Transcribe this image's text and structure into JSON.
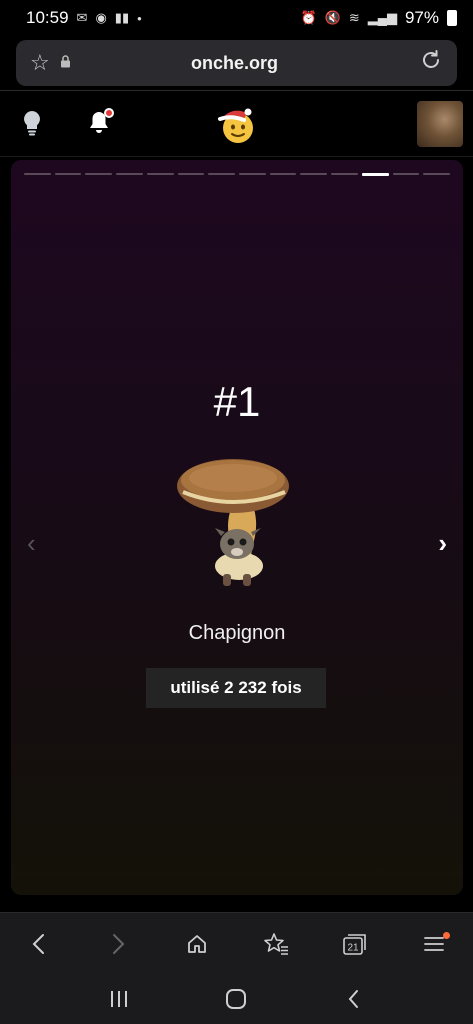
{
  "status_bar": {
    "time": "10:59",
    "battery": "97%"
  },
  "browser": {
    "url": "onche.org"
  },
  "story": {
    "progress_total": 14,
    "progress_active_index": 11,
    "rank": "#1",
    "sticker_name": "Chapignon",
    "usage": "utilisé 2 232 fois"
  },
  "toolbar": {
    "tabs_count": "21"
  },
  "colors": {
    "card_top": "#1e0820",
    "card_bottom": "#141208",
    "notification_dot": "#e53935",
    "menu_dot": "#ff6a3d"
  },
  "icons": [
    "star-icon",
    "lock-icon",
    "reload-icon",
    "bulb-icon",
    "bell-icon",
    "logo-icon",
    "avatar",
    "chevron-left-icon",
    "chevron-right-icon",
    "back-icon",
    "forward-icon",
    "home-icon",
    "bookmarks-icon",
    "tabs-icon",
    "menu-icon",
    "recents-icon",
    "home-nav-icon",
    "back-nav-icon"
  ]
}
